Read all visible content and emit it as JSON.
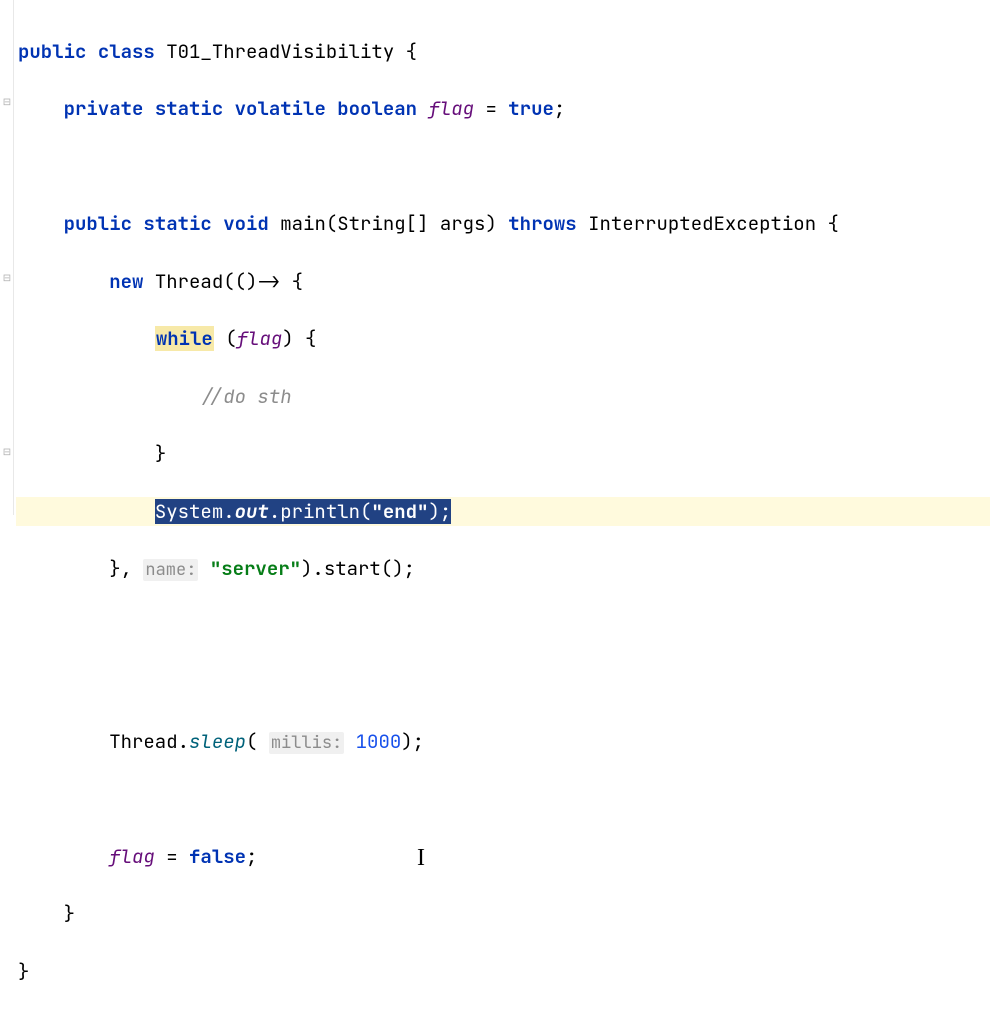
{
  "code": {
    "l1": {
      "kw_public": "public",
      "kw_class": "class",
      "classname": "T01_ThreadVisibility",
      "brace": " {"
    },
    "l2": {
      "kw_private": "private",
      "kw_static": "static",
      "kw_volatile": "volatile",
      "kw_boolean": "boolean",
      "field": "flag",
      "eq": " = ",
      "kw_true": "true",
      "semi": ";"
    },
    "l4": {
      "kw_public": "public",
      "kw_static": "static",
      "kw_void": "void",
      "method": "main",
      "params": "(String[] args)",
      "kw_throws": "throws",
      "exception": "InterruptedException",
      "brace": " {"
    },
    "l5": {
      "kw_new": "new",
      "thread": "Thread",
      "lambda": "(()-> {"
    },
    "l6": {
      "kw_while": "while",
      "open": " (",
      "flag": "flag",
      "close": ") {"
    },
    "l7": {
      "comment": "//do sth"
    },
    "l8": {
      "brace": "}"
    },
    "l9": {
      "system": "System",
      "dot1": ".",
      "out": "out",
      "dot2": ".",
      "println": "println",
      "open": "(",
      "str": "\"end\"",
      "close": ");"
    },
    "l10": {
      "close_lambda": "}, ",
      "hint": "name:",
      "space": " ",
      "str": "\"server\"",
      "rest": ").",
      "start": "start",
      "end": "();"
    },
    "l13": {
      "thread": "Thread",
      "dot": ".",
      "sleep": "sleep",
      "open": "(",
      "hint": "millis:",
      "space": " ",
      "num": "1000",
      "close": ");"
    },
    "l15": {
      "flag": "flag",
      "eq": " = ",
      "kw_false": "false",
      "semi": ";"
    },
    "l16": {
      "brace": "}"
    },
    "l17": {
      "brace": "}"
    }
  },
  "caret_char": "I"
}
